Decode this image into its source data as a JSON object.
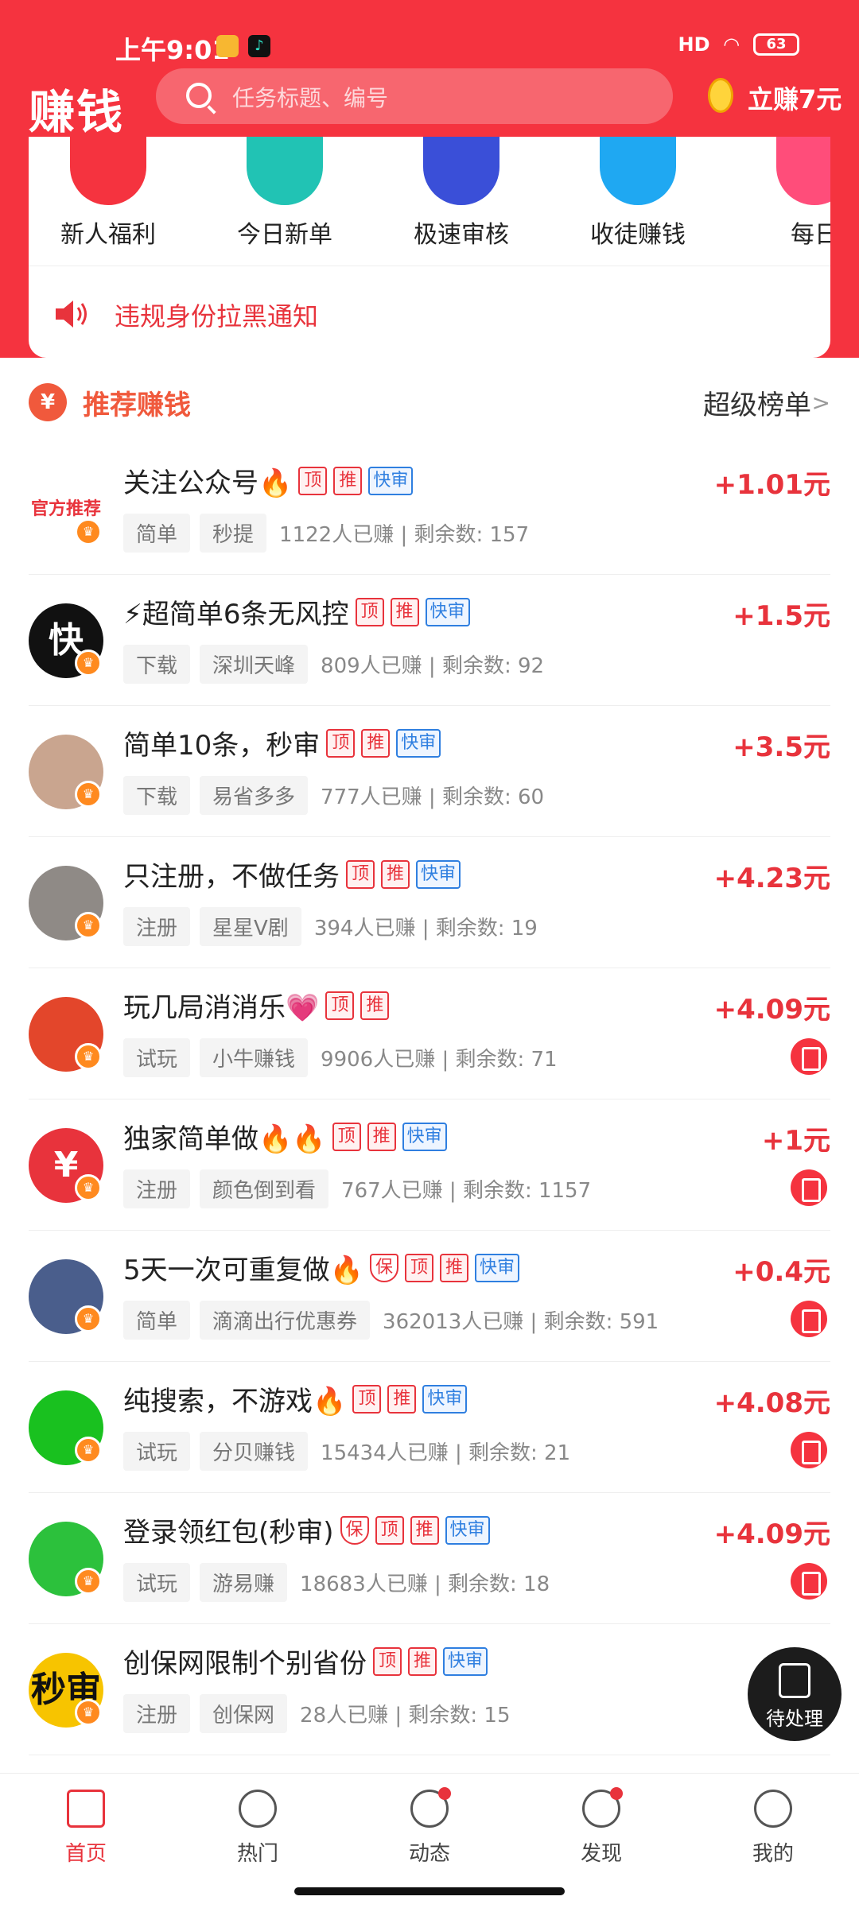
{
  "status": {
    "time": "上午9:01",
    "signal": "HD",
    "battery": "63"
  },
  "header": {
    "logo": "赚钱",
    "search_placeholder": "任务标题、编号",
    "earn_label": "立赚7元"
  },
  "categories": [
    {
      "label": "新人福利",
      "icon": "red-envelope-icon",
      "color": "#f5333f"
    },
    {
      "label": "今日新单",
      "icon": "new-badge-icon",
      "color": "#21c3b4"
    },
    {
      "label": "极速审核",
      "icon": "flash-review-icon",
      "color": "#3a4fd8"
    },
    {
      "label": "收徒赚钱",
      "icon": "recruit-icon",
      "color": "#1fa8f2"
    },
    {
      "label": "每日",
      "icon": "daily-icon",
      "color": "#ff4d7a"
    }
  ],
  "notice": {
    "text": "违规身份拉黑通知"
  },
  "section": {
    "icon_glyph": "¥",
    "title": "推荐赚钱",
    "more": "超级榜单",
    "chevron": ">"
  },
  "tasks": [
    {
      "title": "关注公众号🔥",
      "badges": [
        "顶",
        "推",
        "快审"
      ],
      "tag1": "简单",
      "tag2": "秒提",
      "meta": "1122人已赚 | 剩余数: 157",
      "reward": "+1.01元",
      "avatar_text": "官方推荐",
      "avatar_color": "#ffffff",
      "clip": false
    },
    {
      "title": "⚡超简单6条无风控",
      "badges": [
        "顶",
        "推",
        "快审"
      ],
      "tag1": "下载",
      "tag2": "深圳天峰",
      "meta": "809人已赚 | 剩余数: 92",
      "reward": "+1.5元",
      "avatar_text": "快",
      "avatar_color": "#111111",
      "clip": false
    },
    {
      "title": "简单10条，秒审",
      "badges": [
        "顶",
        "推",
        "快审"
      ],
      "tag1": "下载",
      "tag2": "易省多多",
      "meta": "777人已赚 | 剩余数: 60",
      "reward": "+3.5元",
      "avatar_text": "",
      "avatar_color": "#c9a58f",
      "clip": false
    },
    {
      "title": "只注册，不做任务",
      "badges": [
        "顶",
        "推",
        "快审"
      ],
      "tag1": "注册",
      "tag2": "星星V剧",
      "meta": "394人已赚 | 剩余数: 19",
      "reward": "+4.23元",
      "avatar_text": "",
      "avatar_color": "#8f8a86",
      "clip": false
    },
    {
      "title": "玩几局消消乐💗",
      "badges": [
        "顶",
        "推"
      ],
      "tag1": "试玩",
      "tag2": "小牛赚钱",
      "meta": "9906人已赚 | 剩余数: 71",
      "reward": "+4.09元",
      "avatar_text": "",
      "avatar_color": "#e3462b",
      "clip": true
    },
    {
      "title": "独家简单做🔥🔥",
      "badges": [
        "顶",
        "推",
        "快审"
      ],
      "tag1": "注册",
      "tag2": "颜色倒到看",
      "meta": "767人已赚 | 剩余数: 1157",
      "reward": "+1元",
      "avatar_text": "¥",
      "avatar_color": "#e8333c",
      "clip": true
    },
    {
      "title": "5天一次可重复做🔥",
      "badges": [
        "保",
        "顶",
        "推",
        "快审"
      ],
      "tag1": "简单",
      "tag2": "滴滴出行优惠券",
      "meta": "362013人已赚 | 剩余数: 591",
      "reward": "+0.4元",
      "avatar_text": "",
      "avatar_color": "#4a5e8c",
      "clip": true
    },
    {
      "title": "纯搜索，不游戏🔥",
      "badges": [
        "顶",
        "推",
        "快审"
      ],
      "tag1": "试玩",
      "tag2": "分贝赚钱",
      "meta": "15434人已赚 | 剩余数: 21",
      "reward": "+4.08元",
      "avatar_text": "",
      "avatar_color": "#19c11f",
      "clip": true
    },
    {
      "title": "登录领红包(秒审)",
      "badges": [
        "保",
        "顶",
        "推",
        "快审"
      ],
      "tag1": "试玩",
      "tag2": "游易赚",
      "meta": "18683人已赚 | 剩余数: 18",
      "reward": "+4.09元",
      "avatar_text": "",
      "avatar_color": "#2cc13c",
      "clip": true
    },
    {
      "title": "创保网限制个别省份",
      "badges": [
        "顶",
        "推",
        "快审"
      ],
      "tag1": "注册",
      "tag2": "创保网",
      "meta": "28人已赚 | 剩余数: 15",
      "reward": "",
      "avatar_text": "秒审",
      "avatar_color": "#f7c400",
      "clip": false
    }
  ],
  "floating": {
    "label": "待处理"
  },
  "nav": [
    {
      "label": "首页",
      "icon": "home-icon",
      "active": true,
      "dot": false
    },
    {
      "label": "热门",
      "icon": "hot-icon",
      "active": false,
      "dot": false
    },
    {
      "label": "动态",
      "icon": "broadcast-icon",
      "active": false,
      "dot": true
    },
    {
      "label": "发现",
      "icon": "compass-icon",
      "active": false,
      "dot": true
    },
    {
      "label": "我的",
      "icon": "profile-icon",
      "active": false,
      "dot": false
    }
  ],
  "colors": {
    "brand_red": "#f5333f",
    "price_red": "#e8333c",
    "quick_blue": "#2f7fe0"
  }
}
